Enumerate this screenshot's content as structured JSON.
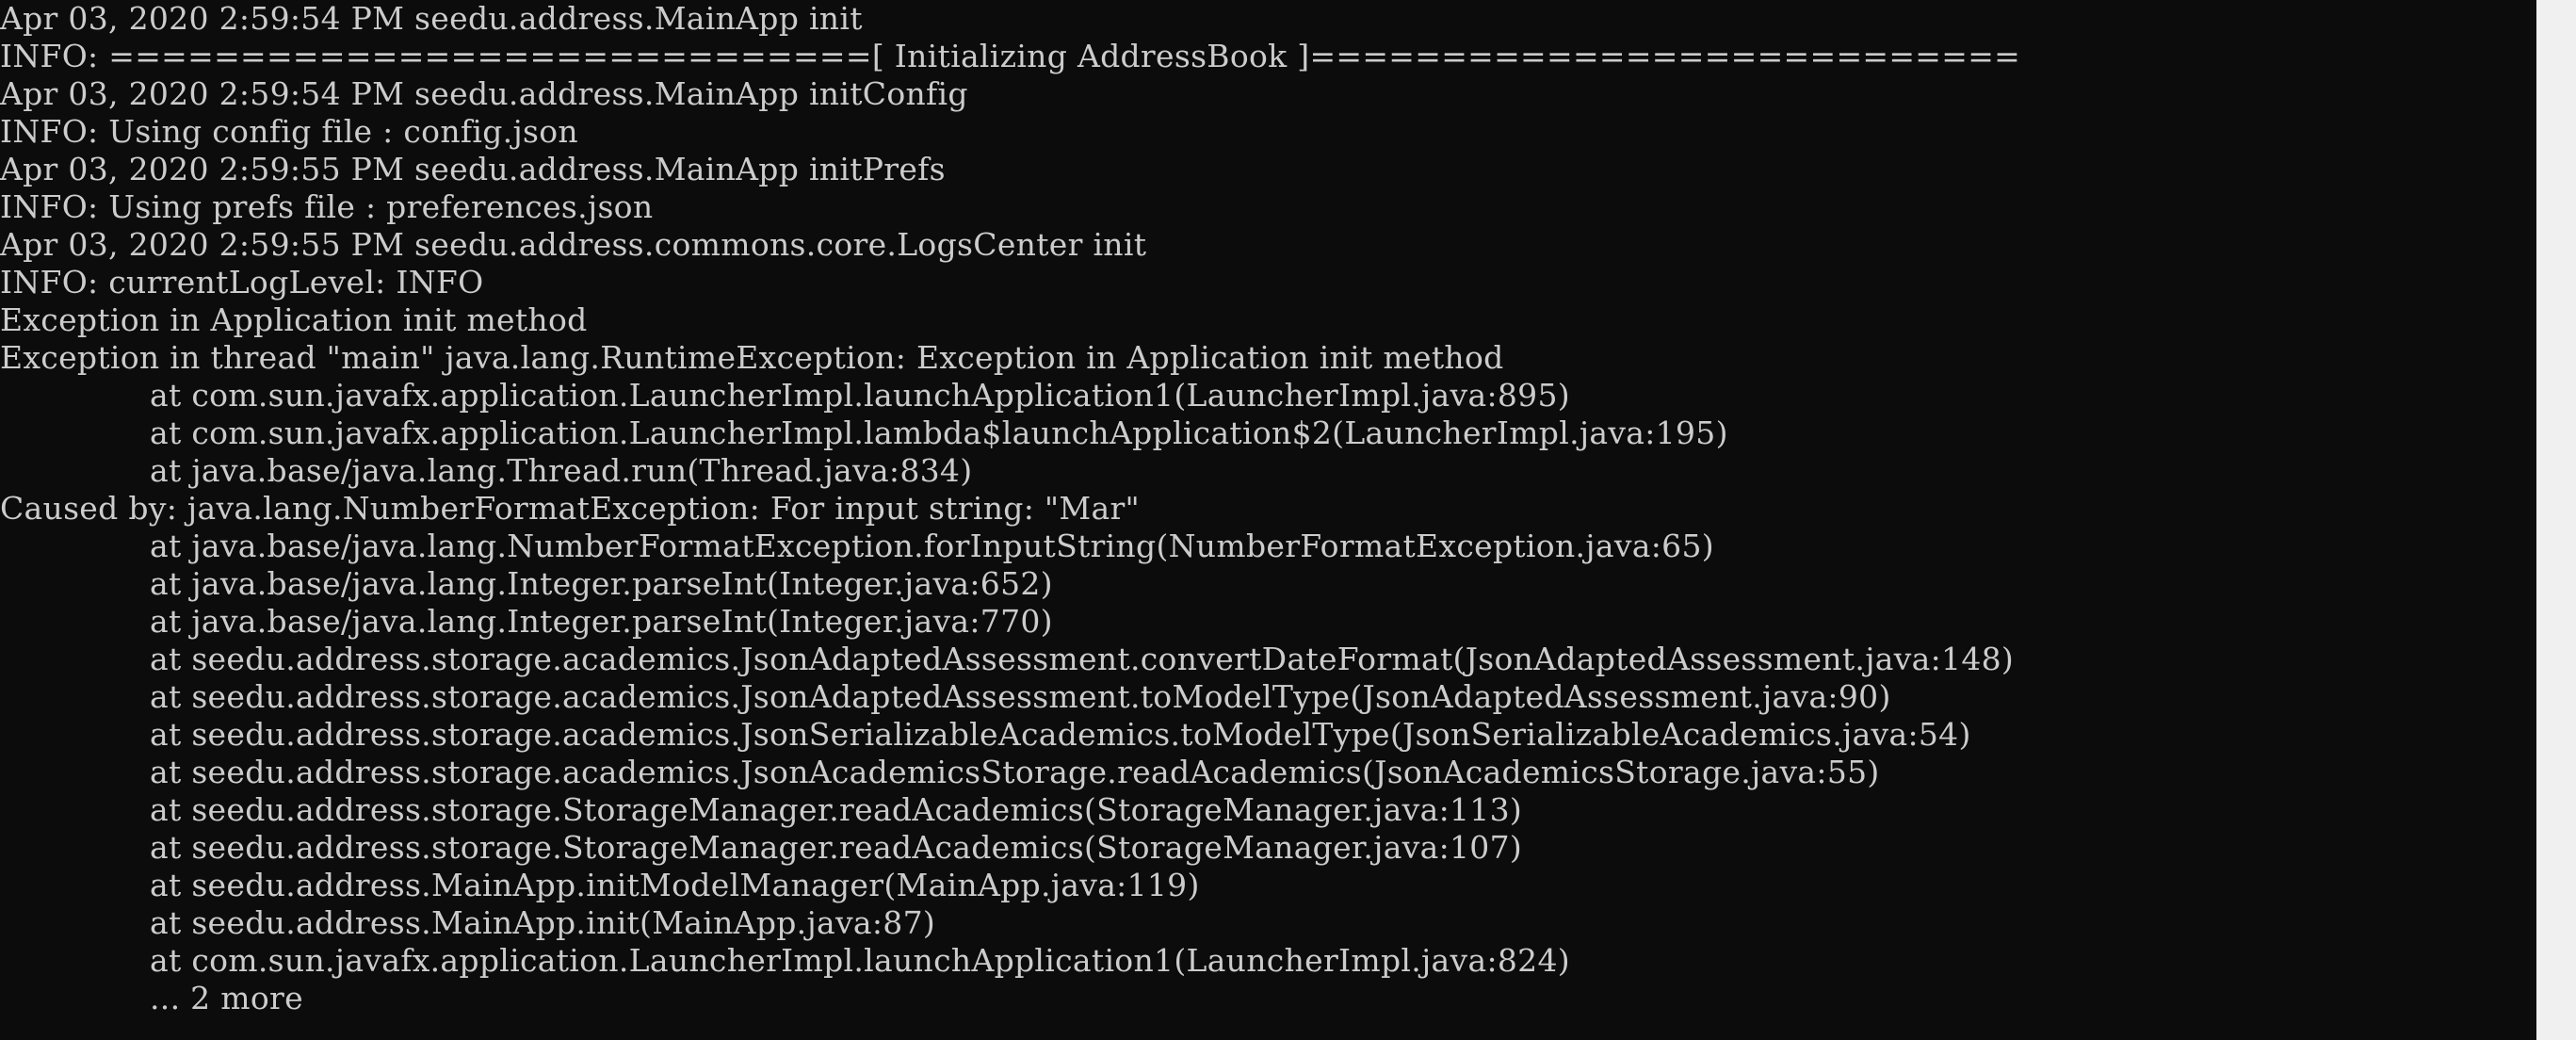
{
  "console": {
    "lines": [
      {
        "text": "Apr 03, 2020 2:59:54 PM seedu.address.MainApp init",
        "indent": false
      },
      {
        "text": "INFO: =============================[ Initializing AddressBook ]===========================",
        "indent": false
      },
      {
        "text": "Apr 03, 2020 2:59:54 PM seedu.address.MainApp initConfig",
        "indent": false
      },
      {
        "text": "INFO: Using config file : config.json",
        "indent": false
      },
      {
        "text": "Apr 03, 2020 2:59:55 PM seedu.address.MainApp initPrefs",
        "indent": false
      },
      {
        "text": "INFO: Using prefs file : preferences.json",
        "indent": false
      },
      {
        "text": "Apr 03, 2020 2:59:55 PM seedu.address.commons.core.LogsCenter init",
        "indent": false
      },
      {
        "text": "INFO: currentLogLevel: INFO",
        "indent": false
      },
      {
        "text": "Exception in Application init method",
        "indent": false
      },
      {
        "text": "Exception in thread \"main\" java.lang.RuntimeException: Exception in Application init method",
        "indent": false
      },
      {
        "text": "at com.sun.javafx.application.LauncherImpl.launchApplication1(LauncherImpl.java:895)",
        "indent": true
      },
      {
        "text": "at com.sun.javafx.application.LauncherImpl.lambda$launchApplication$2(LauncherImpl.java:195)",
        "indent": true
      },
      {
        "text": "at java.base/java.lang.Thread.run(Thread.java:834)",
        "indent": true
      },
      {
        "text": "Caused by: java.lang.NumberFormatException: For input string: \"Mar\"",
        "indent": false
      },
      {
        "text": "at java.base/java.lang.NumberFormatException.forInputString(NumberFormatException.java:65)",
        "indent": true
      },
      {
        "text": "at java.base/java.lang.Integer.parseInt(Integer.java:652)",
        "indent": true
      },
      {
        "text": "at java.base/java.lang.Integer.parseInt(Integer.java:770)",
        "indent": true
      },
      {
        "text": "at seedu.address.storage.academics.JsonAdaptedAssessment.convertDateFormat(JsonAdaptedAssessment.java:148)",
        "indent": true
      },
      {
        "text": "at seedu.address.storage.academics.JsonAdaptedAssessment.toModelType(JsonAdaptedAssessment.java:90)",
        "indent": true
      },
      {
        "text": "at seedu.address.storage.academics.JsonSerializableAcademics.toModelType(JsonSerializableAcademics.java:54)",
        "indent": true
      },
      {
        "text": "at seedu.address.storage.academics.JsonAcademicsStorage.readAcademics(JsonAcademicsStorage.java:55)",
        "indent": true
      },
      {
        "text": "at seedu.address.storage.StorageManager.readAcademics(StorageManager.java:113)",
        "indent": true
      },
      {
        "text": "at seedu.address.storage.StorageManager.readAcademics(StorageManager.java:107)",
        "indent": true
      },
      {
        "text": "at seedu.address.MainApp.initModelManager(MainApp.java:119)",
        "indent": true
      },
      {
        "text": "at seedu.address.MainApp.init(MainApp.java:87)",
        "indent": true
      },
      {
        "text": "at com.sun.javafx.application.LauncherImpl.launchApplication1(LauncherImpl.java:824)",
        "indent": true
      },
      {
        "text": "... 2 more",
        "indent": true
      }
    ]
  },
  "colors": {
    "background": "#0c0c0c",
    "text": "#cccccc",
    "scrollbar": "#f0f0f0"
  }
}
